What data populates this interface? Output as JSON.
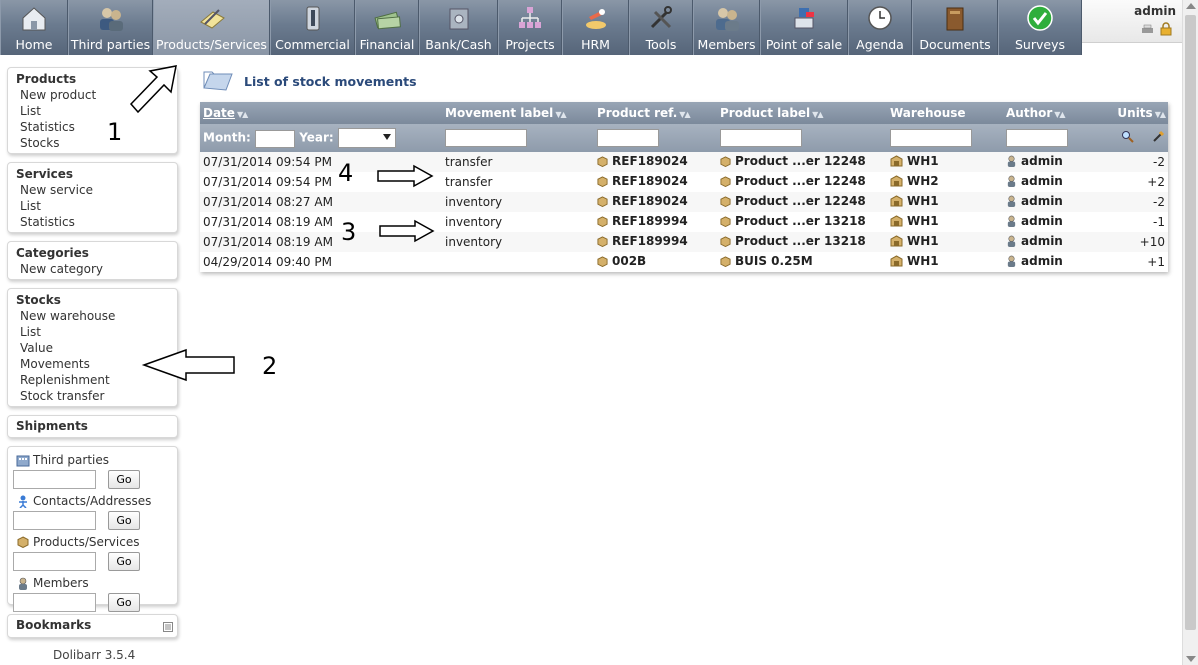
{
  "topmenu": [
    {
      "label": "Home",
      "icon": "home-icon"
    },
    {
      "label": "Third parties",
      "icon": "company-icon"
    },
    {
      "label": "Products/Services",
      "icon": "products-icon",
      "active": true
    },
    {
      "label": "Commercial",
      "icon": "commercial-icon"
    },
    {
      "label": "Financial",
      "icon": "money-icon"
    },
    {
      "label": "Bank/Cash",
      "icon": "bank-icon"
    },
    {
      "label": "Projects",
      "icon": "project-icon"
    },
    {
      "label": "HRM",
      "icon": "hrm-icon"
    },
    {
      "label": "Tools",
      "icon": "tools-icon"
    },
    {
      "label": "Members",
      "icon": "members-icon"
    },
    {
      "label": "Point of sale",
      "icon": "cashdesk-icon"
    },
    {
      "label": "Agenda",
      "icon": "clock-icon"
    },
    {
      "label": "Documents",
      "icon": "documents-icon"
    },
    {
      "label": "Surveys",
      "icon": "check-icon"
    }
  ],
  "user": {
    "login": "admin"
  },
  "sidebar": {
    "products": {
      "title": "Products",
      "items": [
        "New product",
        "List",
        "Statistics",
        "Stocks"
      ]
    },
    "services": {
      "title": "Services",
      "items": [
        "New service",
        "List",
        "Statistics"
      ]
    },
    "categories": {
      "title": "Categories",
      "items": [
        "New category"
      ]
    },
    "stocks": {
      "title": "Stocks",
      "items": [
        "New warehouse",
        "List",
        "Value",
        "Movements",
        "Replenishment",
        "Stock transfer"
      ]
    },
    "shipments": {
      "title": "Shipments"
    },
    "search": {
      "thirdparties": "Third parties",
      "contacts": "Contacts/Addresses",
      "products": "Products/Services",
      "members": "Members",
      "go": "Go"
    },
    "bookmarks": {
      "title": "Bookmarks"
    },
    "version": "Dolibarr 3.5.4"
  },
  "page": {
    "title": "List of stock movements"
  },
  "table": {
    "headers": {
      "date": "Date",
      "movement": "Movement label",
      "ref": "Product ref.",
      "label": "Product label",
      "warehouse": "Warehouse",
      "author": "Author",
      "units": "Units"
    },
    "filter": {
      "month": "Month:",
      "year": "Year:"
    },
    "rows": [
      {
        "date": "07/31/2014 09:54 PM",
        "movement": "transfer",
        "ref": "REF189024",
        "label": "Product ...er 12248",
        "warehouse": "WH1",
        "author": "admin",
        "units": "-2"
      },
      {
        "date": "07/31/2014 09:54 PM",
        "movement": "transfer",
        "ref": "REF189024",
        "label": "Product ...er 12248",
        "warehouse": "WH2",
        "author": "admin",
        "units": "+2"
      },
      {
        "date": "07/31/2014 08:27 AM",
        "movement": "inventory",
        "ref": "REF189024",
        "label": "Product ...er 12248",
        "warehouse": "WH1",
        "author": "admin",
        "units": "-2"
      },
      {
        "date": "07/31/2014 08:19 AM",
        "movement": "inventory",
        "ref": "REF189994",
        "label": "Product ...er 13218",
        "warehouse": "WH1",
        "author": "admin",
        "units": "-1"
      },
      {
        "date": "07/31/2014 08:19 AM",
        "movement": "inventory",
        "ref": "REF189994",
        "label": "Product ...er 13218",
        "warehouse": "WH1",
        "author": "admin",
        "units": "+10"
      },
      {
        "date": "04/29/2014 09:40 PM",
        "movement": "",
        "ref": "002B",
        "label": "BUIS 0.25M",
        "warehouse": "WH1",
        "author": "admin",
        "units": "+1"
      }
    ]
  },
  "annotations": [
    "1",
    "2",
    "3",
    "4"
  ]
}
